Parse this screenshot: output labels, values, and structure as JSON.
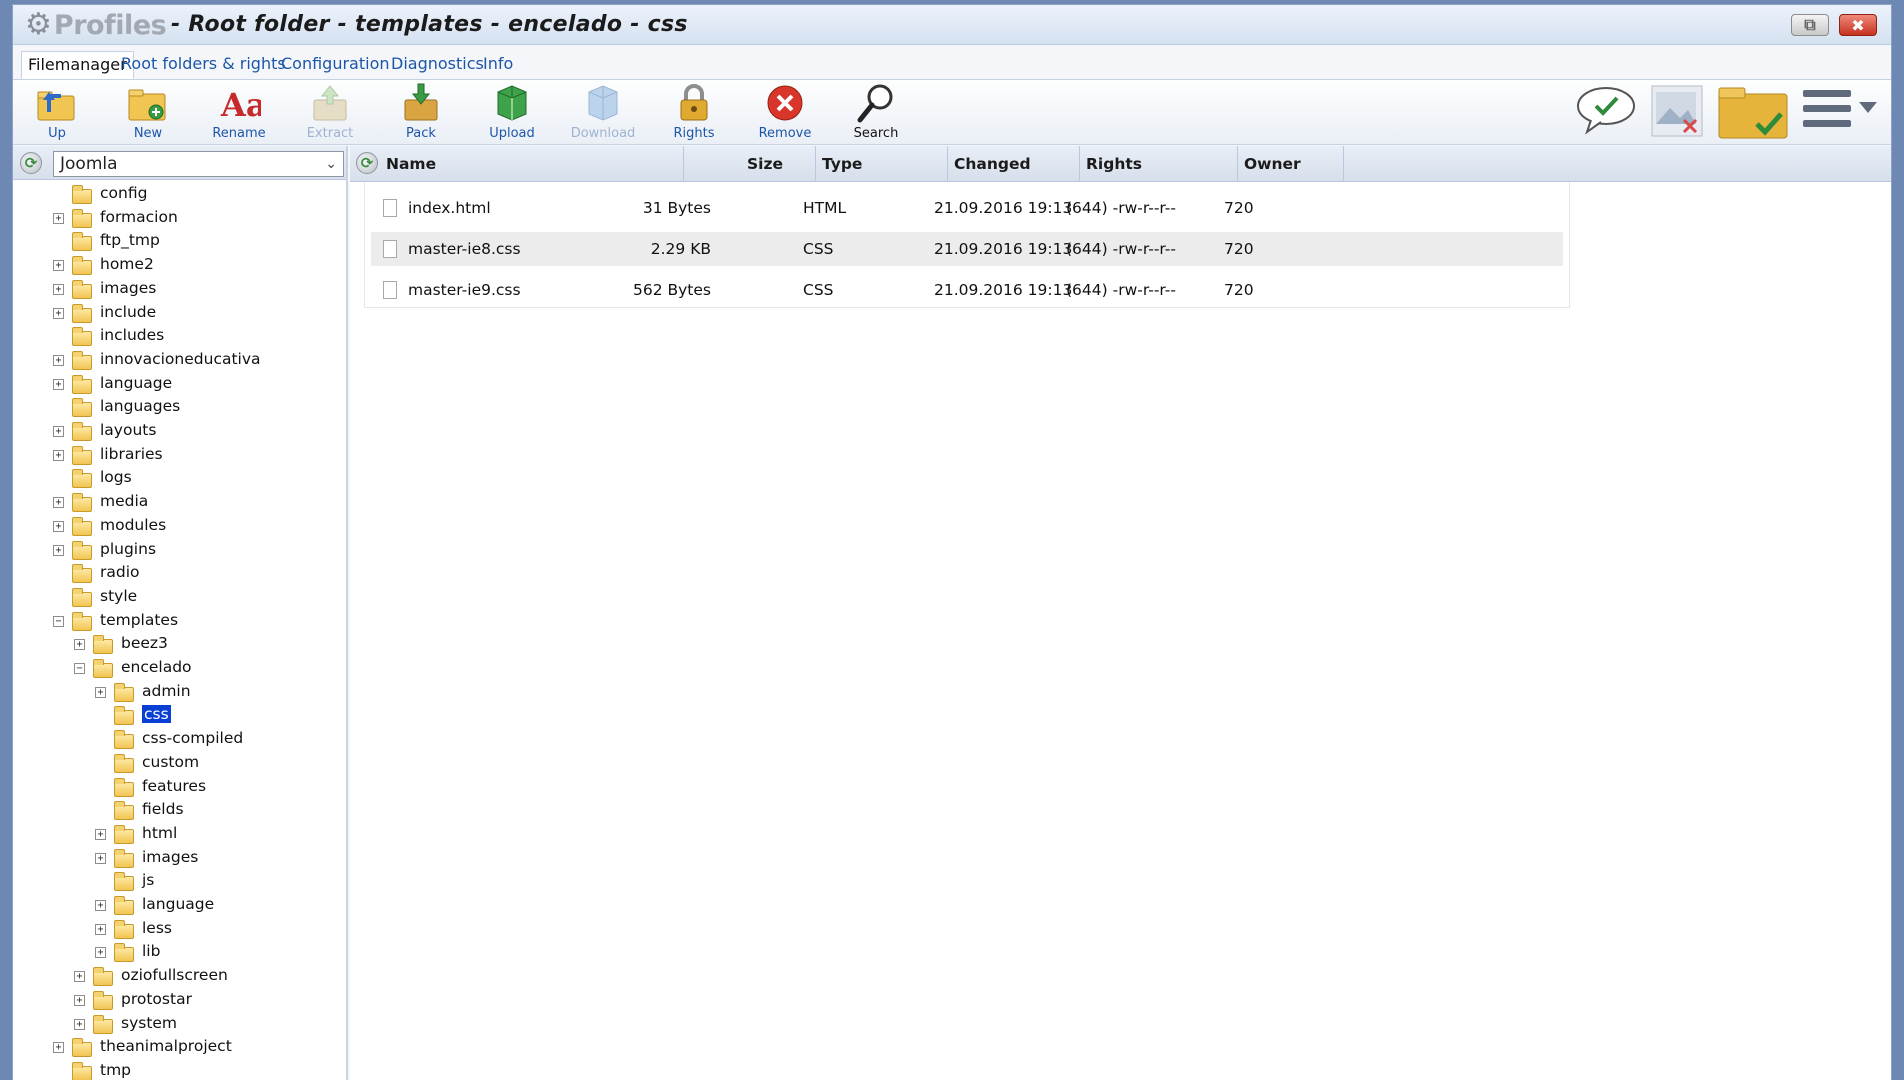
{
  "window": {
    "brand": "Profiles",
    "title": "- Root folder - templates - encelado - css"
  },
  "menu": {
    "tabs": [
      "Filemanager",
      "Root folders & rights",
      "Configuration",
      "Diagnostics",
      "Info"
    ]
  },
  "toolbar": {
    "buttons": [
      "Up",
      "New",
      "Rename",
      "Extract",
      "Pack",
      "Upload",
      "Download",
      "Rights",
      "Remove",
      "Search"
    ],
    "disabled": [
      "Extract",
      "Download"
    ]
  },
  "tree": {
    "root_selector": "Joomla",
    "selected": "css",
    "nodes": [
      {
        "label": "config"
      },
      {
        "label": "formacion",
        "toggle": "+"
      },
      {
        "label": "ftp_tmp"
      },
      {
        "label": "home2",
        "toggle": "+"
      },
      {
        "label": "images",
        "toggle": "+"
      },
      {
        "label": "include",
        "toggle": "+"
      },
      {
        "label": "includes"
      },
      {
        "label": "innovacioneducativa",
        "toggle": "+"
      },
      {
        "label": "language",
        "toggle": "+"
      },
      {
        "label": "languages"
      },
      {
        "label": "layouts",
        "toggle": "+"
      },
      {
        "label": "libraries",
        "toggle": "+"
      },
      {
        "label": "logs"
      },
      {
        "label": "media",
        "toggle": "+"
      },
      {
        "label": "modules",
        "toggle": "+"
      },
      {
        "label": "plugins",
        "toggle": "+"
      },
      {
        "label": "radio"
      },
      {
        "label": "style"
      },
      {
        "label": "templates",
        "toggle": "−"
      },
      {
        "label": "beez3",
        "toggle": "+"
      },
      {
        "label": "encelado",
        "toggle": "−"
      },
      {
        "label": "admin",
        "toggle": "+"
      },
      {
        "label": "css"
      },
      {
        "label": "css-compiled"
      },
      {
        "label": "custom"
      },
      {
        "label": "features"
      },
      {
        "label": "fields"
      },
      {
        "label": "html",
        "toggle": "+"
      },
      {
        "label": "images",
        "toggle": "+"
      },
      {
        "label": "js"
      },
      {
        "label": "language",
        "toggle": "+"
      },
      {
        "label": "less",
        "toggle": "+"
      },
      {
        "label": "lib",
        "toggle": "+"
      },
      {
        "label": "oziofullscreen",
        "toggle": "+"
      },
      {
        "label": "protostar",
        "toggle": "+"
      },
      {
        "label": "system",
        "toggle": "+"
      },
      {
        "label": "theanimalproject",
        "toggle": "+"
      },
      {
        "label": "tmp"
      }
    ]
  },
  "filelist": {
    "columns": [
      "Name",
      "Size",
      "Type",
      "Changed",
      "Rights",
      "Owner"
    ],
    "rows": [
      {
        "name": "index.html",
        "size": "31 Bytes",
        "type": "HTML",
        "changed": "21.09.2016 19:13",
        "rights": "(644) -rw-r--r--",
        "owner": "720"
      },
      {
        "name": "master-ie8.css",
        "size": "2.29 KB",
        "type": "CSS",
        "changed": "21.09.2016 19:13",
        "rights": "(644) -rw-r--r--",
        "owner": "720"
      },
      {
        "name": "master-ie9.css",
        "size": "562 Bytes",
        "type": "CSS",
        "changed": "21.09.2016 19:13",
        "rights": "(644) -rw-r--r--",
        "owner": "720"
      }
    ]
  },
  "icons": {
    "window_buttons": [
      "restore-icon",
      "close-icon"
    ],
    "right_tools": [
      "comment-check-icon",
      "image-remove-icon",
      "folder-check-icon",
      "hamburger-menu-icon"
    ]
  },
  "colors": {
    "link_blue": "#1c56a8",
    "selection": "#0a3fd6",
    "close_red": "#c6321f"
  }
}
